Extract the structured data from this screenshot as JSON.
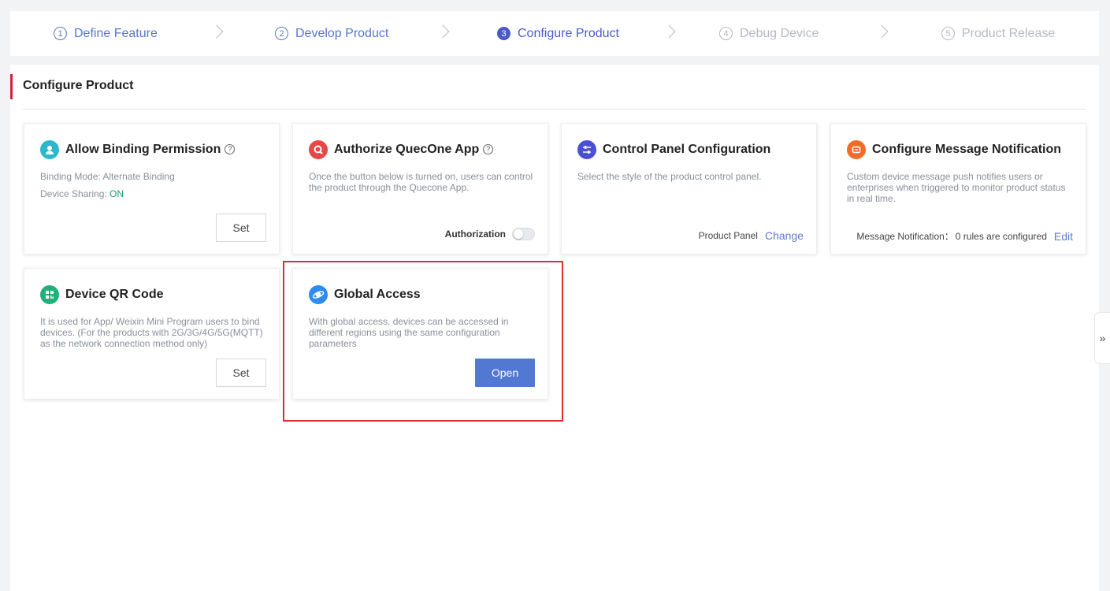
{
  "stepper": {
    "steps": [
      {
        "num": "1",
        "label": "Define Feature",
        "state": "done"
      },
      {
        "num": "2",
        "label": "Develop Product",
        "state": "done"
      },
      {
        "num": "3",
        "label": "Configure Product",
        "state": "active"
      },
      {
        "num": "4",
        "label": "Debug Device",
        "state": "pending"
      },
      {
        "num": "5",
        "label": "Product Release",
        "state": "pending"
      }
    ]
  },
  "section": {
    "title": "Configure Product"
  },
  "cards": {
    "binding": {
      "title": "Allow Binding Permission",
      "help": "?",
      "mode_label": "Binding Mode: Alternate Binding",
      "sharing_label": "Device Sharing: ",
      "sharing_value": "ON",
      "button": "Set"
    },
    "quecone": {
      "title": "Authorize QuecOne App",
      "help": "?",
      "desc": "Once the button below is turned on, users can control the product through the Quecone App.",
      "toggle_label": "Authorization",
      "toggle_on": false
    },
    "panel": {
      "title": "Control Panel Configuration",
      "desc": "Select the style of the product control panel.",
      "foot_label": "Product Panel",
      "link": "Change"
    },
    "message": {
      "title": "Configure Message Notification",
      "desc": "Custom device message push notifies users or enterprises when triggered to monitor product status in real time.",
      "foot_label": "Message Notification：",
      "foot_value": "0 rules are configured",
      "link": "Edit"
    },
    "qr": {
      "title": "Device QR Code",
      "desc": "It is used for App/ Weixin Mini Program users to bind devices. (For the products with 2G/3G/4G/5G(MQTT) as the network connection method only)",
      "button": "Set"
    },
    "global": {
      "title": "Global Access",
      "desc": "With global access, devices can be accessed in different regions using the same configuration parameters",
      "button": "Open"
    }
  },
  "side_tab": {
    "label": "»"
  },
  "colors": {
    "accent": "#4a5bc7",
    "primary_button": "#5178d3",
    "highlight": "#e02c2c",
    "on": "#1a9a6e"
  }
}
